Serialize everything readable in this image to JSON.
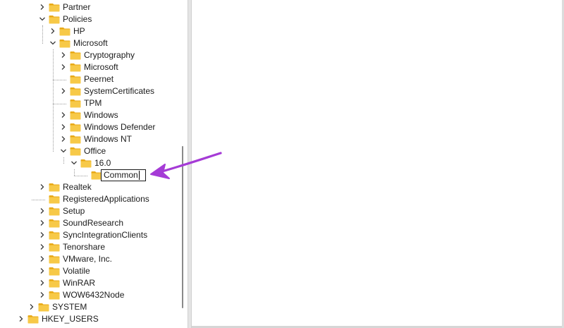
{
  "window": {
    "title": ""
  },
  "tree": {
    "items": [
      {
        "label": "Partner",
        "expander": "collapsed",
        "depth": 3
      },
      {
        "label": "Policies",
        "expander": "expanded",
        "depth": 3
      },
      {
        "label": "HP",
        "expander": "collapsed",
        "depth": 4
      },
      {
        "label": "Microsoft",
        "expander": "expanded",
        "depth": 4
      },
      {
        "label": "Cryptography",
        "expander": "collapsed",
        "depth": 5
      },
      {
        "label": "Microsoft",
        "expander": "collapsed",
        "depth": 5
      },
      {
        "label": "Peernet",
        "expander": "none",
        "depth": 5
      },
      {
        "label": "SystemCertificates",
        "expander": "collapsed",
        "depth": 5
      },
      {
        "label": "TPM",
        "expander": "none",
        "depth": 5
      },
      {
        "label": "Windows",
        "expander": "collapsed",
        "depth": 5
      },
      {
        "label": "Windows Defender",
        "expander": "collapsed",
        "depth": 5
      },
      {
        "label": "Windows NT",
        "expander": "collapsed",
        "depth": 5
      },
      {
        "label": "Office",
        "expander": "expanded",
        "depth": 5
      },
      {
        "label": "16.0",
        "expander": "expanded",
        "depth": 6
      },
      {
        "label": "",
        "expander": "none",
        "depth": 7
      },
      {
        "label": "Realtek",
        "expander": "collapsed",
        "depth": 3
      },
      {
        "label": "RegisteredApplications",
        "expander": "none",
        "depth": 3
      },
      {
        "label": "Setup",
        "expander": "collapsed",
        "depth": 3
      },
      {
        "label": "SoundResearch",
        "expander": "collapsed",
        "depth": 3
      },
      {
        "label": "SyncIntegrationClients",
        "expander": "collapsed",
        "depth": 3
      },
      {
        "label": "Tenorshare",
        "expander": "collapsed",
        "depth": 3
      },
      {
        "label": "VMware, Inc.",
        "expander": "collapsed",
        "depth": 3
      },
      {
        "label": "Volatile",
        "expander": "collapsed",
        "depth": 3
      },
      {
        "label": "WinRAR",
        "expander": "collapsed",
        "depth": 3
      },
      {
        "label": "WOW6432Node",
        "expander": "collapsed",
        "depth": 3
      },
      {
        "label": "SYSTEM",
        "expander": "collapsed",
        "depth": 2
      },
      {
        "label": "HKEY_USERS",
        "expander": "collapsed",
        "depth": 1
      }
    ]
  },
  "rename": {
    "value": "Common"
  },
  "colors": {
    "folder_fill": "#f7c948",
    "folder_tab": "#e8a916",
    "arrow": "#a53bd6",
    "chevron": "#3a3a3a"
  },
  "icons": {
    "folder": "folder-icon",
    "expanded": "chevron-down-icon",
    "collapsed": "chevron-right-icon",
    "annotation": "arrow-icon"
  }
}
